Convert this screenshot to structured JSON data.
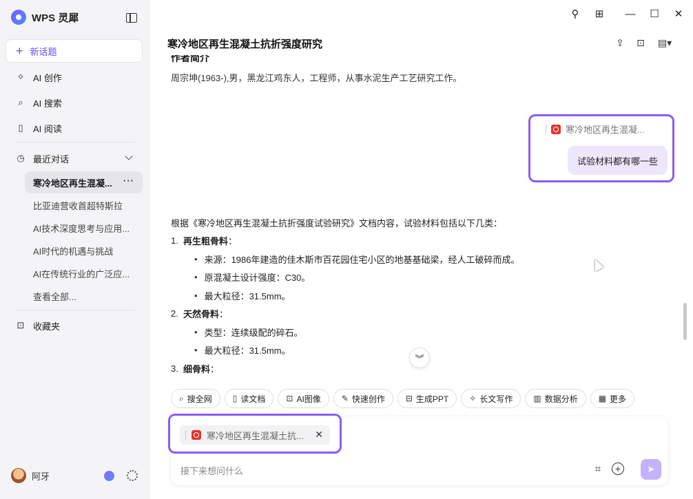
{
  "app": {
    "name": "WPS 灵犀"
  },
  "colors": {
    "accent": "#6b4cf0",
    "highlight_border": "#8a5cf6",
    "pdf_red": "#e5332a",
    "bubble_bg": "#ede7fb"
  },
  "sidebar": {
    "new_topic": "新话题",
    "nav": [
      {
        "label": "AI 创作",
        "icon": "sparkle-icon"
      },
      {
        "label": "AI 搜索",
        "icon": "search-icon"
      },
      {
        "label": "AI 阅读",
        "icon": "book-icon"
      }
    ],
    "recent_label": "最近对话",
    "conversations": [
      "寒冷地区再生混凝...",
      "比亚迪营收首超特斯拉",
      "AI技术深度思考与应用...",
      "AI时代的机遇与挑战",
      "AI在传统行业的广泛应...",
      "查看全部..."
    ],
    "more_icon": "···",
    "favorites": "收藏夹",
    "user_name": "阿牙"
  },
  "header": {
    "title": "寒冷地区再生混凝土抗折强度研究"
  },
  "content": {
    "cut_heading": "作者简介",
    "author_line": "周宗坤(1963-),男，黑龙江鸡东人，工程师，从事水泥生产工艺研究工作。",
    "user_ref": "寒冷地区再生混凝...",
    "user_question": "试验材料都有哪一些",
    "answer_intro": "根据《寒冷地区再生混凝土抗折强度试验研究》文档内容，试验材料包括以下几类：",
    "sections": [
      {
        "num": "1.",
        "title": "再生粗骨料",
        "colon": "：",
        "bullets": [
          "来源：1986年建造的佳木斯市百花园住宅小区的地基基础梁，经人工破碎而成。",
          "原混凝土设计强度：C30。",
          "最大粒径：31.5mm。"
        ]
      },
      {
        "num": "2.",
        "title": "天然骨料",
        "colon": "：",
        "bullets": [
          "类型：连续级配的碎石。",
          "最大粒径：31.5mm。"
        ]
      },
      {
        "num": "3.",
        "title": "细骨料",
        "colon": "：",
        "bullets": []
      }
    ]
  },
  "tools": [
    {
      "label": "搜全网",
      "icon": "search-icon"
    },
    {
      "label": "读文档",
      "icon": "doc-read-icon"
    },
    {
      "label": "AI图像",
      "icon": "image-icon"
    },
    {
      "label": "快速创作",
      "icon": "pen-icon"
    },
    {
      "label": "生成PPT",
      "icon": "ppt-icon"
    },
    {
      "label": "长文写作",
      "icon": "sparkle-icon"
    },
    {
      "label": "数据分析",
      "icon": "chart-icon"
    },
    {
      "label": "更多",
      "icon": "grid-icon"
    }
  ],
  "input": {
    "attachment": "寒冷地区再生混凝土抗...",
    "placeholder": "接下来想问什么"
  }
}
